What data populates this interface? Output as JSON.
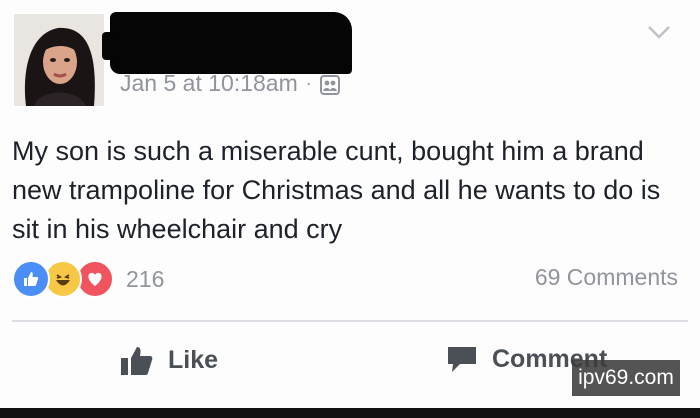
{
  "post": {
    "timestamp": "Jan 5 at 10:18am",
    "separator": "·",
    "privacy_icon": "friends-icon",
    "options_icon": "chevron-down-icon",
    "text": "My son is such a miserable cunt, bought him a brand new trampoline for Christmas and all he wants to do is sit in his wheelchair and cry"
  },
  "reactions": {
    "icons": [
      "like-icon",
      "haha-icon",
      "love-icon"
    ],
    "count": "216"
  },
  "comments": {
    "count_label": "69 Comments"
  },
  "actions": {
    "like_label": "Like",
    "comment_label": "Comment"
  },
  "watermark": {
    "text": "ipv69.com"
  },
  "colors": {
    "like_blue": "#4c8ef7",
    "haha_yellow": "#f7c845",
    "love_red": "#f0555f",
    "meta_gray": "#90949c",
    "action_gray": "#4b4f56"
  }
}
